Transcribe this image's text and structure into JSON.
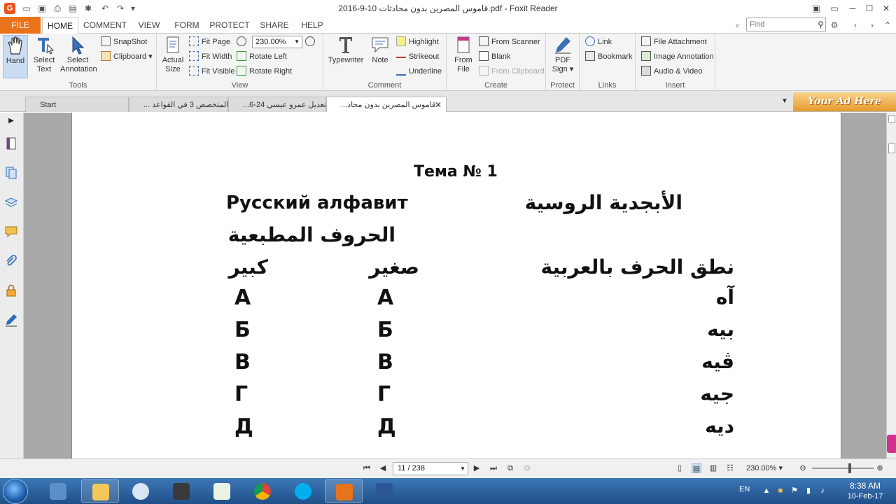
{
  "window": {
    "title": "قاموس المصرين بدون محادثات 10-9-2016.pdf - Foxit Reader",
    "logo_letter": "G"
  },
  "ribbon_tabs": [
    "FILE",
    "HOME",
    "COMMENT",
    "VIEW",
    "FORM",
    "PROTECT",
    "SHARE",
    "HELP"
  ],
  "search": {
    "placeholder": "Find"
  },
  "ribbon": {
    "tools": {
      "label": "Tools",
      "hand": "Hand",
      "select_text": "Select Text",
      "select_annotation": "Select Annotation",
      "snapshot": "SnapShot",
      "clipboard": "Clipboard"
    },
    "view": {
      "label": "View",
      "actual_size": "Actual Size",
      "fit_page": "Fit Page",
      "fit_width": "Fit Width",
      "fit_visible": "Fit Visible",
      "zoom_value": "230.00%",
      "rotate_left": "Rotate Left",
      "rotate_right": "Rotate Right"
    },
    "comment": {
      "label": "Comment",
      "typewriter": "Typewriter",
      "note": "Note",
      "highlight": "Highlight",
      "strikeout": "Strikeout",
      "underline": "Underline"
    },
    "create": {
      "label": "Create",
      "from_file": "From File",
      "from_scanner": "From Scanner",
      "blank": "Blank",
      "from_clipboard": "From Clipboard"
    },
    "protect": {
      "label": "Protect",
      "pdf_sign": "PDF Sign"
    },
    "links": {
      "label": "Links",
      "link": "Link",
      "bookmark": "Bookmark"
    },
    "insert": {
      "label": "Insert",
      "file_attachment": "File Attachment",
      "image_annotation": "Image Annotation",
      "audio_video": "Audio & Video"
    }
  },
  "doc_tabs": [
    {
      "label": "Start"
    },
    {
      "label": "... المتخصص 3 في القواعد"
    },
    {
      "label": "...تعديل عمرو عيسي 24-6"
    },
    {
      "label": "...قاموس المصرين بدون محاد"
    }
  ],
  "ad_banner": "Your Ad Here",
  "page_content": {
    "heading": "Тема № 1",
    "russian_alphabet": "Русский алфавит",
    "arabic_alphabet": "الأبجدية الروسية",
    "printed_letters": "الحروف المطبعية",
    "col_capital": "كبير",
    "col_small": "صغير",
    "col_pronunciation": "نطق الحرف بالعربية",
    "letters": [
      {
        "capital": "А",
        "small": "А",
        "arabic": "آه"
      },
      {
        "capital": "Б",
        "small": "Б",
        "arabic": "بيه"
      },
      {
        "capital": "В",
        "small": "В",
        "arabic": "ڤيه"
      },
      {
        "capital": "Г",
        "small": "Г",
        "arabic": "جيه"
      },
      {
        "capital": "Д",
        "small": "Д",
        "arabic": "ديه"
      }
    ]
  },
  "statusbar": {
    "page_indicator": "11 / 238",
    "zoom": "230.00%"
  },
  "taskbar": {
    "language": "EN",
    "time": "8:38 AM",
    "date": "10-Feb-17"
  }
}
